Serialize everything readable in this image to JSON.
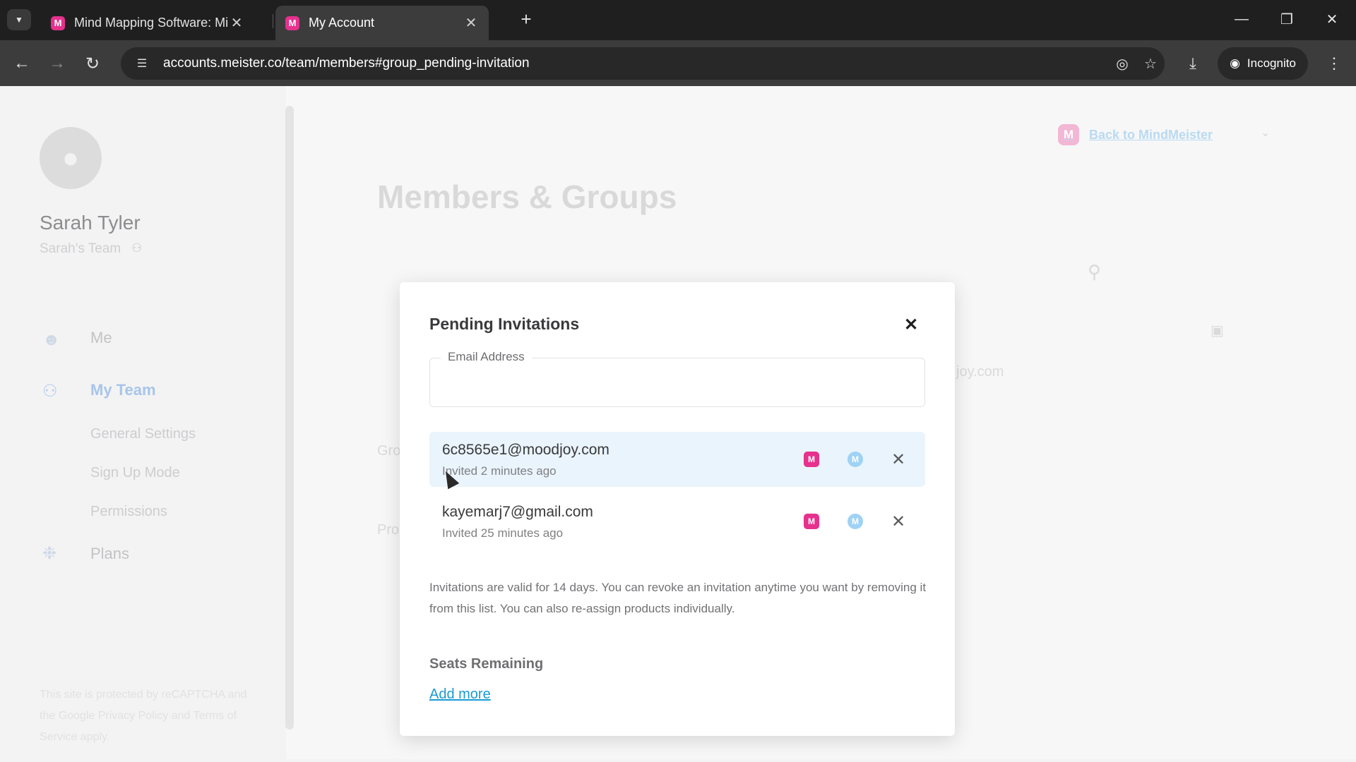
{
  "browser": {
    "tabs": [
      {
        "title": "Mind Mapping Software: Mind",
        "favicon": "M"
      },
      {
        "title": "My Account",
        "favicon": "M"
      }
    ],
    "url": "accounts.meister.co/team/members#group_pending-invitation",
    "incognito_label": "Incognito"
  },
  "sidebar": {
    "user_name": "Sarah Tyler",
    "team_name": "Sarah's Team",
    "nav": {
      "me": "Me",
      "my_team": "My Team",
      "general_settings": "General Settings",
      "sign_up_mode": "Sign Up Mode",
      "permissions": "Permissions",
      "plans": "Plans"
    },
    "recaptcha_text": "This site is protected by reCAPTCHA and the Google Privacy Policy and Terms of Service apply."
  },
  "main": {
    "back_link": "Back to MindMeister",
    "page_title": "Members & Groups",
    "fragment_email": "joy.com",
    "fragment_groups": "Gro",
    "fragment_products": "Pro"
  },
  "modal": {
    "title": "Pending Invitations",
    "email_label": "Email Address",
    "email_value": "",
    "invitations": [
      {
        "email": "6c8565e1@moodjoy.com",
        "time": "Invited 2 minutes ago",
        "highlighted": true
      },
      {
        "email": "kayemarj7@gmail.com",
        "time": "Invited 25 minutes ago",
        "highlighted": false
      }
    ],
    "info_text": "Invitations are valid for 14 days. You can revoke an invitation anytime you want by removing it from this list. You can also re-assign products individually.",
    "seats_label": "Seats Remaining",
    "add_more": "Add more"
  },
  "icons": {
    "mindmeister": "M",
    "meistertask": "M"
  },
  "colors": {
    "mindmeister_pink": "#e6318d",
    "meistertask_blue": "#9fd2f5",
    "link_blue": "#1a9ad6",
    "row_highlight": "#eaf4fc"
  }
}
